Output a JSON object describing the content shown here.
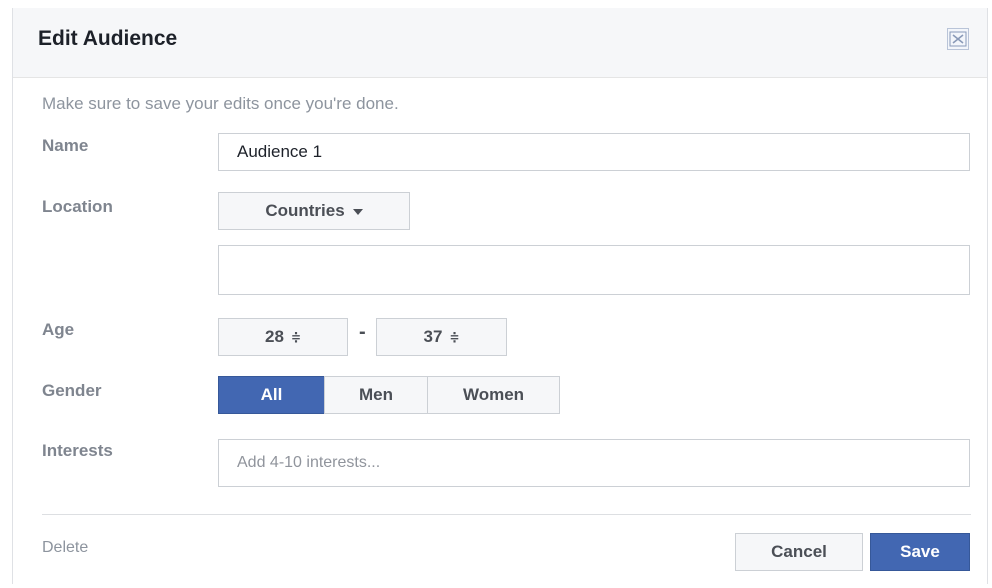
{
  "dialog": {
    "title": "Edit Audience",
    "hint": "Make sure to save your edits once you're done.",
    "close_icon": "close-icon"
  },
  "form": {
    "name": {
      "label": "Name",
      "value": "Audience 1"
    },
    "location": {
      "label": "Location",
      "dropdown_label": "Countries",
      "value": ""
    },
    "age": {
      "label": "Age",
      "min": "28",
      "max": "37",
      "separator": "-",
      "stepper_glyph": "≑"
    },
    "gender": {
      "label": "Gender",
      "options": [
        "All",
        "Men",
        "Women"
      ],
      "selected": "All"
    },
    "interests": {
      "label": "Interests",
      "placeholder": "Add 4-10 interests..."
    }
  },
  "footer": {
    "delete_label": "Delete",
    "cancel_label": "Cancel",
    "save_label": "Save"
  },
  "colors": {
    "primary": "#4267b2",
    "header_bg": "#f6f7f9",
    "border": "#ccd0d5",
    "muted_text": "#8d949e"
  }
}
